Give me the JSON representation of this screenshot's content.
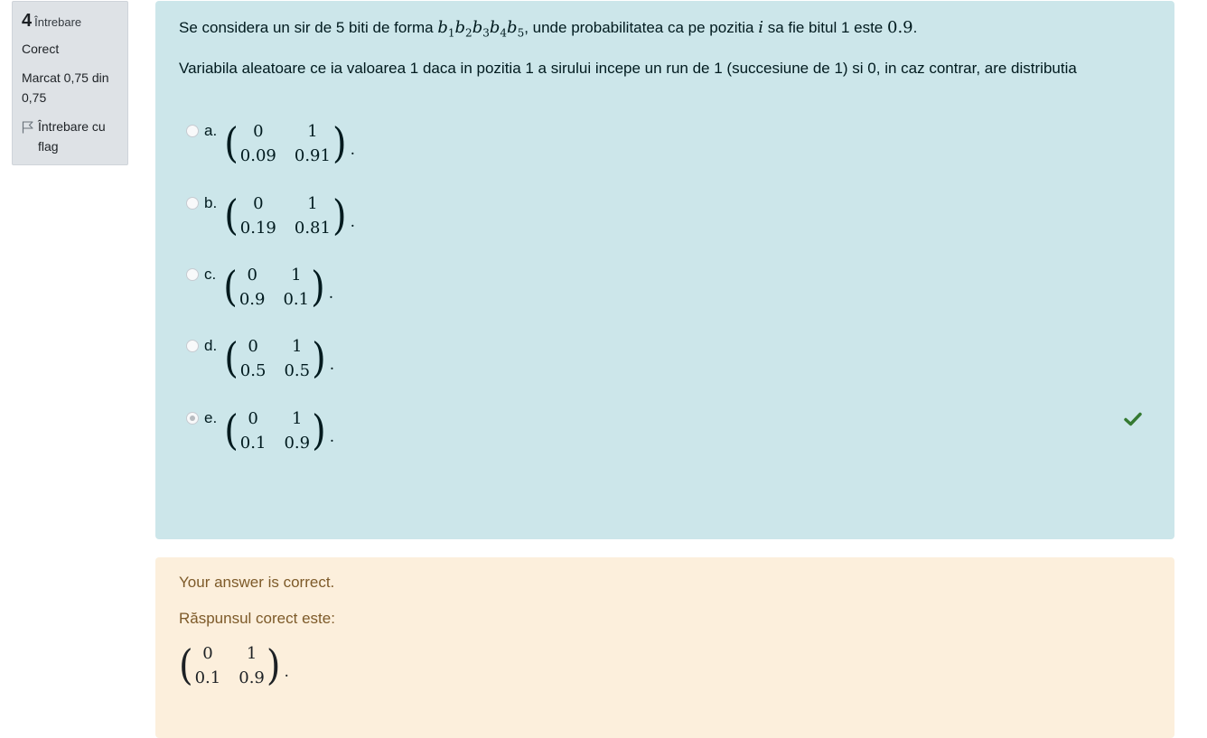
{
  "info": {
    "number": "4",
    "label": "Întrebare",
    "state": "Corect",
    "grade": "Marcat 0,75 din 0,75",
    "flag_label": "Întrebare cu flag"
  },
  "question": {
    "text_part1": "Se considera un sir de 5 biti de forma",
    "text_part2": ", unde probabilitatea ca pe pozitia",
    "var_i": "i",
    "text_part3": "sa fie bitul 1 este",
    "prob": "0.9",
    "text_end": ".",
    "bits": [
      {
        "b": "b",
        "sub": "1"
      },
      {
        "b": "b",
        "sub": "2"
      },
      {
        "b": "b",
        "sub": "3"
      },
      {
        "b": "b",
        "sub": "4"
      },
      {
        "b": "b",
        "sub": "5"
      }
    ],
    "paragraph2": "Variabila aleatoare ce ia valoarea 1 daca in pozitia 1 a sirului incepe un run de 1 (succesiune de 1) si 0, in caz contrar, are distributia"
  },
  "options": [
    {
      "letter": "a.",
      "top": [
        "0",
        "1"
      ],
      "bottom": [
        "0.09",
        "0.91"
      ],
      "dot": ".",
      "selected": false
    },
    {
      "letter": "b.",
      "top": [
        "0",
        "1"
      ],
      "bottom": [
        "0.19",
        "0.81"
      ],
      "dot": ".",
      "selected": false
    },
    {
      "letter": "c.",
      "top": [
        "0",
        "1"
      ],
      "bottom": [
        "0.9",
        "0.1"
      ],
      "dot": ".",
      "selected": false
    },
    {
      "letter": "d.",
      "top": [
        "0",
        "1"
      ],
      "bottom": [
        "0.5",
        "0.5"
      ],
      "dot": ".",
      "selected": false
    },
    {
      "letter": "e.",
      "top": [
        "0",
        "1"
      ],
      "bottom": [
        "0.1",
        "0.9"
      ],
      "dot": ".",
      "selected": true
    }
  ],
  "feedback": {
    "message": "Your answer is correct.",
    "correct_label": "Răspunsul corect este:",
    "answer": {
      "top": [
        "0",
        "1"
      ],
      "bottom": [
        "0.1",
        "0.9"
      ],
      "dot": "."
    }
  },
  "colors": {
    "formulation_bg": "#cce6ea",
    "feedback_bg": "#fcefdc",
    "check": "#357a32"
  },
  "icons": {
    "flag": "flag-outline-icon",
    "check": "check-icon"
  }
}
